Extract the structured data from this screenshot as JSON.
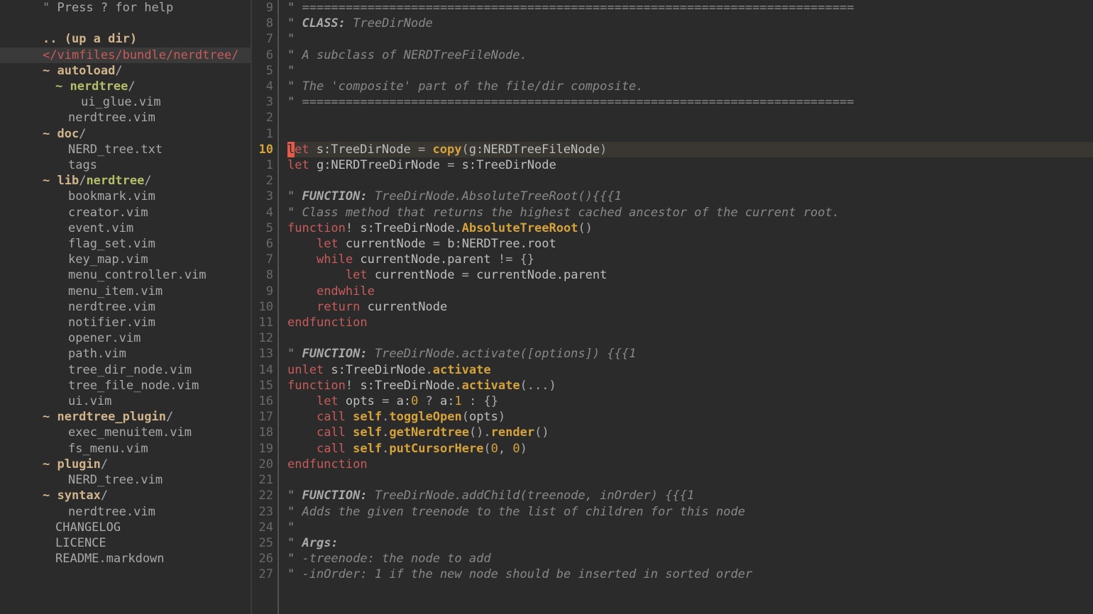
{
  "sidebar": {
    "help_quote": "\"",
    "help": " Press ? for help",
    "up_prefix": "..",
    "up_label": " (up a dir)",
    "root": "</vimfiles/bundle/nerdtree/",
    "entries": [
      {
        "type": "dir",
        "indent": 0,
        "tilde": "~",
        "name": "autoload",
        "slash": "/"
      },
      {
        "type": "dir",
        "indent": 1,
        "tilde": "~",
        "name": "nerdtree",
        "slash": "/",
        "subdir": true
      },
      {
        "type": "file",
        "indent": 3,
        "name": "ui_glue.vim"
      },
      {
        "type": "file",
        "indent": 2,
        "name": "nerdtree.vim"
      },
      {
        "type": "dir",
        "indent": 0,
        "tilde": "~",
        "name": "doc",
        "slash": "/"
      },
      {
        "type": "file",
        "indent": 2,
        "name": "NERD_tree.txt"
      },
      {
        "type": "file",
        "indent": 2,
        "name": "tags"
      },
      {
        "type": "dirsplit",
        "indent": 0,
        "tilde": "~",
        "name1": "lib",
        "name2": "nerdtree",
        "slash": "/"
      },
      {
        "type": "file",
        "indent": 2,
        "name": "bookmark.vim"
      },
      {
        "type": "file",
        "indent": 2,
        "name": "creator.vim"
      },
      {
        "type": "file",
        "indent": 2,
        "name": "event.vim"
      },
      {
        "type": "file",
        "indent": 2,
        "name": "flag_set.vim"
      },
      {
        "type": "file",
        "indent": 2,
        "name": "key_map.vim"
      },
      {
        "type": "file",
        "indent": 2,
        "name": "menu_controller.vim"
      },
      {
        "type": "file",
        "indent": 2,
        "name": "menu_item.vim"
      },
      {
        "type": "file",
        "indent": 2,
        "name": "nerdtree.vim"
      },
      {
        "type": "file",
        "indent": 2,
        "name": "notifier.vim"
      },
      {
        "type": "file",
        "indent": 2,
        "name": "opener.vim"
      },
      {
        "type": "file",
        "indent": 2,
        "name": "path.vim"
      },
      {
        "type": "file",
        "indent": 2,
        "name": "tree_dir_node.vim"
      },
      {
        "type": "file",
        "indent": 2,
        "name": "tree_file_node.vim"
      },
      {
        "type": "file",
        "indent": 2,
        "name": "ui.vim"
      },
      {
        "type": "dir",
        "indent": 0,
        "tilde": "~",
        "name": "nerdtree_plugin",
        "slash": "/"
      },
      {
        "type": "file",
        "indent": 2,
        "name": "exec_menuitem.vim"
      },
      {
        "type": "file",
        "indent": 2,
        "name": "fs_menu.vim"
      },
      {
        "type": "dir",
        "indent": 0,
        "tilde": "~",
        "name": "plugin",
        "slash": "/"
      },
      {
        "type": "file",
        "indent": 2,
        "name": "NERD_tree.vim"
      },
      {
        "type": "dir",
        "indent": 0,
        "tilde": "~",
        "name": "syntax",
        "slash": "/"
      },
      {
        "type": "file",
        "indent": 2,
        "name": "nerdtree.vim"
      },
      {
        "type": "file",
        "indent": 1,
        "name": "CHANGELOG"
      },
      {
        "type": "file",
        "indent": 1,
        "name": "LICENCE"
      },
      {
        "type": "file",
        "indent": 1,
        "name": "README.markdown"
      }
    ]
  },
  "gutter": [
    "9",
    "8",
    "7",
    "6",
    "5",
    "4",
    "3",
    "2",
    "1",
    "10",
    "1",
    "2",
    "3",
    "4",
    "5",
    "6",
    "7",
    "8",
    "9",
    "10",
    "11",
    "12",
    "13",
    "14",
    "15",
    "16",
    "17",
    "18",
    "19",
    "20",
    "21",
    "22",
    "23",
    "24",
    "25",
    "26",
    "27"
  ],
  "gutter_current_index": 9,
  "code": {
    "l0": {
      "q": "\"",
      "rule": " ============================================================================"
    },
    "l1": {
      "q": "\"",
      "lbl": " CLASS: ",
      "val": "TreeDirNode"
    },
    "l2": {
      "q": "\""
    },
    "l3": {
      "q": "\"",
      "txt": " A subclass of NERDTreeFileNode."
    },
    "l4": {
      "q": "\""
    },
    "l5": {
      "q": "\"",
      "txt": " The 'composite' part of the file/dir composite."
    },
    "l6": {
      "q": "\"",
      "rule": " ============================================================================"
    },
    "l9": {
      "cursor": "l",
      "kw": "et",
      "id1": " s:TreeDirNode",
      "eq": " = ",
      "fn": "copy",
      "op": "(",
      "id2": "g:NERDTreeFileNode",
      "cp": ")"
    },
    "l10": {
      "kw": "let",
      "id1": " g:NERDTreeDirNode",
      "eq": " = ",
      "id2": "s:TreeDirNode"
    },
    "l12": {
      "q": "\"",
      "lbl": " FUNCTION: ",
      "val": "TreeDirNode.AbsoluteTreeRoot(){{{1"
    },
    "l13": {
      "q": "\"",
      "txt": " Class method that returns the highest cached ancestor of the current root."
    },
    "l14": {
      "kw": "function",
      "bang": "!",
      "id": " s:TreeDirNode.",
      "fn": "AbsoluteTreeRoot",
      "par": "()"
    },
    "l15": {
      "ind": "    ",
      "kw": "let",
      "id1": " currentNode",
      "eq": " = ",
      "id2": "b:NERDTree",
      "dot": ".root"
    },
    "l16": {
      "ind": "    ",
      "kw": "while",
      "id": " currentNode.parent ",
      "op": "!=",
      "br": " {}"
    },
    "l17": {
      "ind": "        ",
      "kw": "let",
      "id1": " currentNode",
      "eq": " = ",
      "id2": "currentNode.parent"
    },
    "l18": {
      "ind": "    ",
      "kw": "endwhile"
    },
    "l19": {
      "ind": "    ",
      "kw": "return",
      "id": " currentNode"
    },
    "l20": {
      "kw": "endfunction"
    },
    "l22": {
      "q": "\"",
      "lbl": " FUNCTION: ",
      "val": "TreeDirNode.activate([options]) {{{1"
    },
    "l23": {
      "kw": "unlet",
      "id": " s:TreeDirNode",
      "dot": ".",
      "fn": "activate"
    },
    "l24": {
      "kw": "function",
      "bang": "!",
      "id": " s:TreeDirNode.",
      "fn": "activate",
      "par": "(...)"
    },
    "l25": {
      "ind": "    ",
      "kw": "let",
      "id1": " opts",
      "eq": " = ",
      "id2": "a:",
      "n0": "0",
      "tern": " ? ",
      "id3": "a:",
      "n1": "1",
      "col": " : ",
      "br": "{}"
    },
    "l26": {
      "ind": "    ",
      "kw": "call",
      "self": " self",
      "dot": ".",
      "fn": "toggleOpen",
      "op": "(",
      "arg": "opts",
      "cp": ")"
    },
    "l27": {
      "ind": "    ",
      "kw": "call",
      "self": " self",
      "dot": ".",
      "fn": "getNerdtree",
      "par": "()",
      "dot2": ".",
      "fn2": "render",
      "par2": "()"
    },
    "l28": {
      "ind": "    ",
      "kw": "call",
      "self": " self",
      "dot": ".",
      "fn": "putCursorHere",
      "op": "(",
      "n0": "0",
      "c": ", ",
      "n1": "0",
      "cp": ")"
    },
    "l29": {
      "kw": "endfunction"
    },
    "l31": {
      "q": "\"",
      "lbl": " FUNCTION: ",
      "val": "TreeDirNode.addChild(treenode, inOrder) {{{1"
    },
    "l32": {
      "q": "\"",
      "txt": " Adds the given treenode to the list of children for this node"
    },
    "l33": {
      "q": "\""
    },
    "l34": {
      "q": "\"",
      "lbl": " Args:"
    },
    "l35": {
      "q": "\"",
      "txt": " -treenode: the node to add"
    },
    "l36": {
      "q": "\"",
      "txt": " -inOrder: 1 if the new node should be inserted in sorted order"
    }
  }
}
